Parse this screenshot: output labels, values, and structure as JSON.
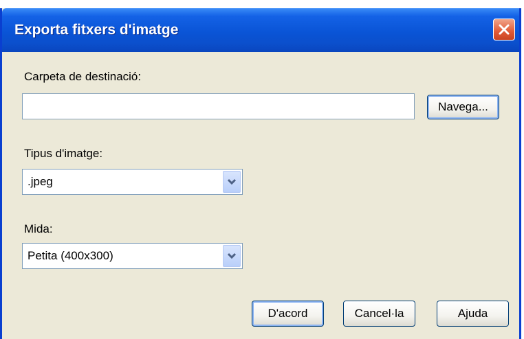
{
  "window": {
    "title": "Exporta fitxers d'imatge",
    "close_icon": "close-icon"
  },
  "destination": {
    "label": "Carpeta de destinació:",
    "value": "",
    "browse_label": "Navega..."
  },
  "image_type": {
    "label": "Tipus d'imatge:",
    "selected": ".jpeg",
    "dropdown_icon": "chevron-down-icon"
  },
  "size": {
    "label": "Mida:",
    "selected": "Petita (400x300)",
    "dropdown_icon": "chevron-down-icon"
  },
  "buttons": {
    "ok_label": "D'acord",
    "cancel_label": "Cancel·la",
    "help_label": "Ajuda"
  },
  "colors": {
    "titlebar": "#0a54d6",
    "window_bg": "#ece9d8",
    "close": "#e15a36"
  }
}
